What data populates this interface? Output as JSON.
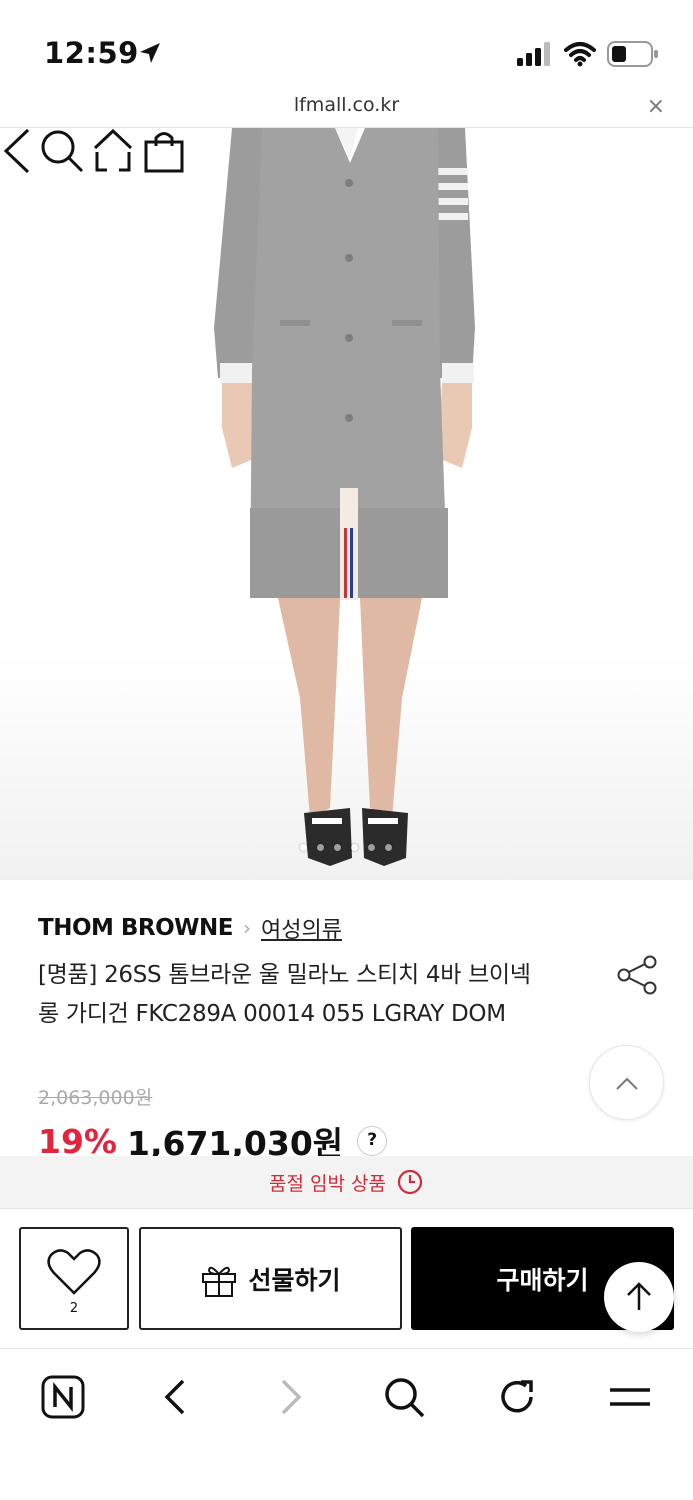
{
  "status_bar": {
    "time": "12:59"
  },
  "browser": {
    "url": "lfmall.co.kr",
    "close_symbol": "×"
  },
  "product": {
    "brand": "THOM BROWNE",
    "category": "여성의류",
    "title": "[명품] 26SS 톰브라운 울 밀라노 스티치 4바 브이넥 롱 가디건 FKC289A 00014 055 LGRAY DOM",
    "original_price": "2,063,000원",
    "discount": "19%",
    "price": "1,671,030원",
    "help_symbol": "?"
  },
  "notice": {
    "text": "품절 임박 상품"
  },
  "purchase_bar": {
    "wish_count": "2",
    "gift_label": "선물하기",
    "buy_label": "구매하기"
  },
  "colors": {
    "accent": "#e2253c",
    "buy_bg": "#000000"
  }
}
